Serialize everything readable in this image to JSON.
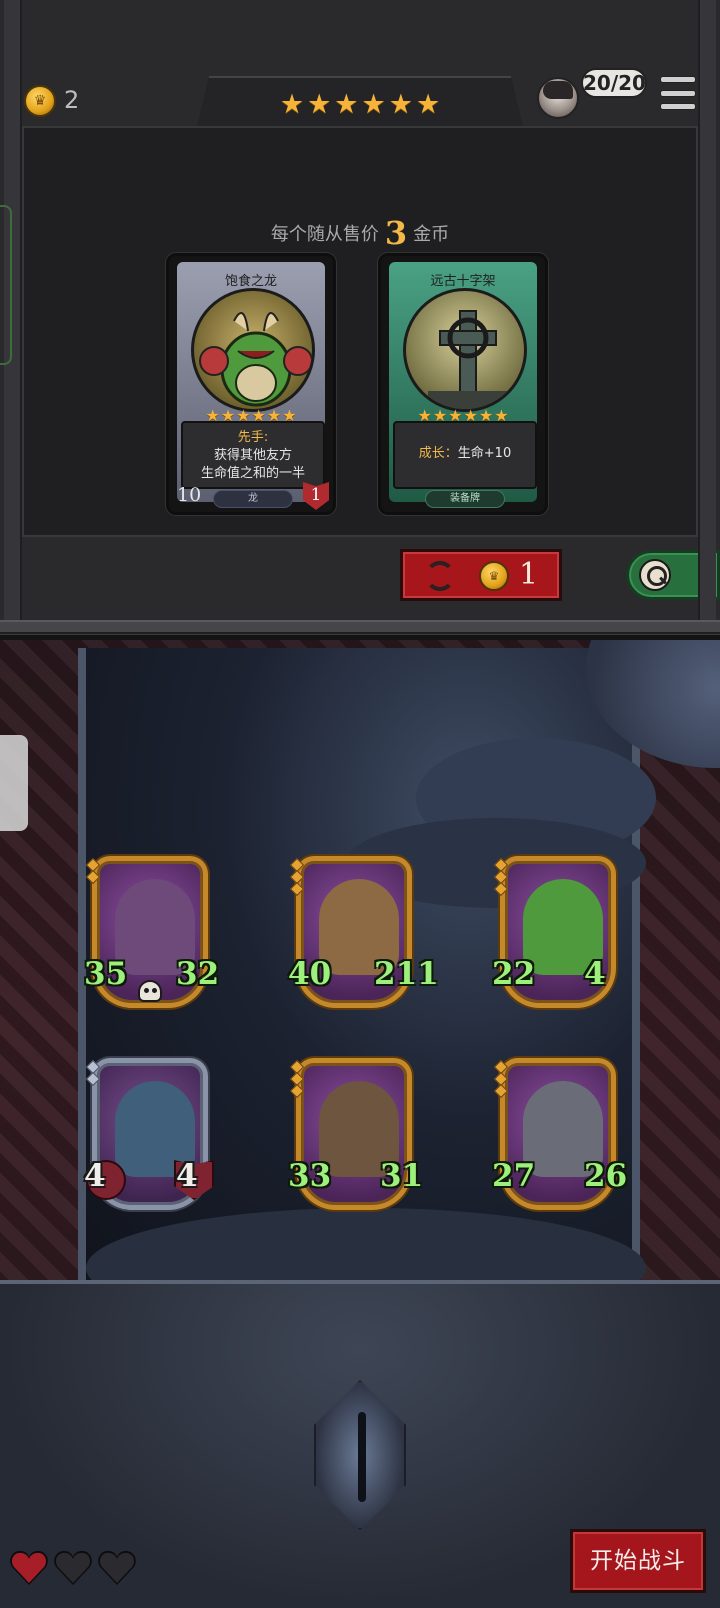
{
  "header": {
    "gold": "2",
    "tavern_stars": 6,
    "star_glyph": "★",
    "health_display": "20/20",
    "colors": {
      "gold": "#f6b33a",
      "panel": "#1f1f21"
    }
  },
  "shop": {
    "sell_prefix": "每个随从售价",
    "sell_amount": "3",
    "sell_suffix": "金币",
    "cards": [
      {
        "name": "饱食之龙",
        "stars": 6,
        "keyword": "先手",
        "keyword_suffix": ":",
        "desc_line1": "获得其他友方",
        "desc_line2": "生命值之和的一半",
        "attack": "10",
        "health": "1",
        "tribe": "龙",
        "portrait_icon": "dragon-icon",
        "frame_color": "#8f95a8"
      },
      {
        "name": "远古十字架",
        "stars": 6,
        "desc": "成长：生命+10",
        "desc_kw": "成长：",
        "desc_value": "生命+10",
        "tribe": "装备牌",
        "portrait_icon": "celtic-cross-icon",
        "frame_color": "#3f8a6e"
      }
    ],
    "reroll_cost": "1"
  },
  "board": {
    "minions": [
      {
        "name": "octopus-wizard",
        "attack": "35",
        "health": "32",
        "tier": 2,
        "frame": "gold",
        "buffed": true
      },
      {
        "name": "bear-captain",
        "attack": "40",
        "health": "211",
        "tier": 3,
        "frame": "gold",
        "buffed": true
      },
      {
        "name": "dragon",
        "attack": "22",
        "health": "4",
        "tier": 3,
        "frame": "gold",
        "buffed": true
      },
      {
        "name": "bat-demon",
        "attack": "4",
        "health": "4",
        "tier": 2,
        "frame": "silver",
        "buffed": false
      },
      {
        "name": "swordsman",
        "attack": "33",
        "health": "31",
        "tier": 3,
        "frame": "gold",
        "buffed": true
      },
      {
        "name": "robot-knight",
        "attack": "27",
        "health": "26",
        "tier": 3,
        "frame": "gold",
        "buffed": true
      }
    ]
  },
  "footer": {
    "lives_total": 3,
    "lives_remaining": 1,
    "start_battle_label": "开始战斗"
  }
}
